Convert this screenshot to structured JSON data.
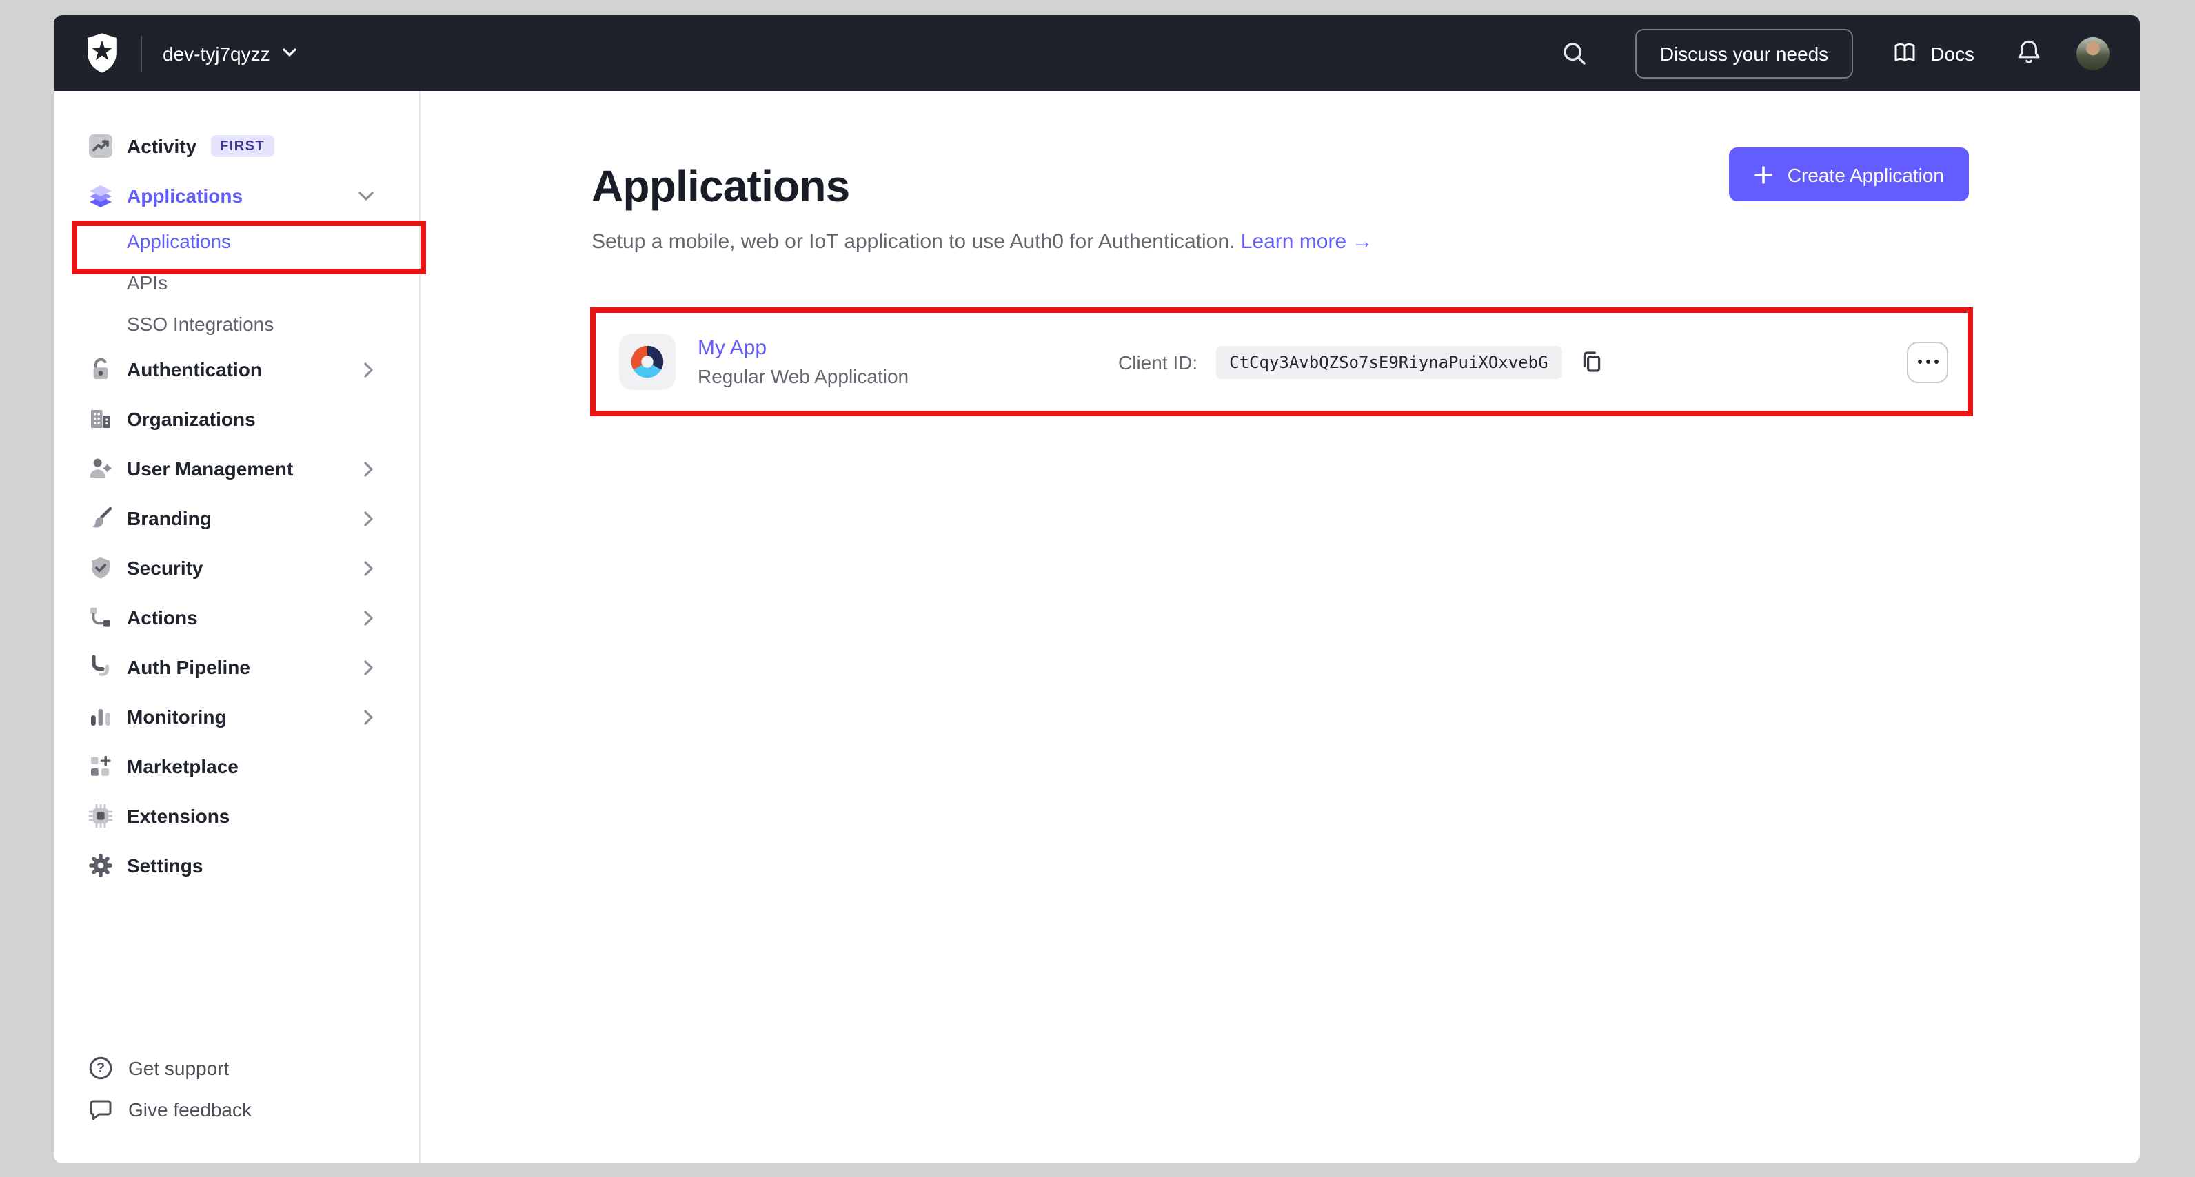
{
  "topbar": {
    "tenant": "dev-tyj7qyzz",
    "discuss_label": "Discuss your needs",
    "docs_label": "Docs"
  },
  "sidebar": {
    "items": [
      {
        "label": "Activity",
        "icon": "activity-icon",
        "badge": "FIRST"
      },
      {
        "label": "Applications",
        "icon": "layers-icon",
        "chevron": "down",
        "active": true,
        "children": [
          {
            "label": "Applications",
            "active": true
          },
          {
            "label": "APIs"
          },
          {
            "label": "SSO Integrations"
          }
        ]
      },
      {
        "label": "Authentication",
        "icon": "lock-icon",
        "chevron": "right"
      },
      {
        "label": "Organizations",
        "icon": "building-icon"
      },
      {
        "label": "User Management",
        "icon": "user-gear-icon",
        "chevron": "right"
      },
      {
        "label": "Branding",
        "icon": "paintbrush-icon",
        "chevron": "right"
      },
      {
        "label": "Security",
        "icon": "shield-check-icon",
        "chevron": "right"
      },
      {
        "label": "Actions",
        "icon": "flow-icon",
        "chevron": "right"
      },
      {
        "label": "Auth Pipeline",
        "icon": "pipeline-icon",
        "chevron": "right"
      },
      {
        "label": "Monitoring",
        "icon": "bar-chart-icon",
        "chevron": "right"
      },
      {
        "label": "Marketplace",
        "icon": "grid-plus-icon"
      },
      {
        "label": "Extensions",
        "icon": "chip-icon"
      },
      {
        "label": "Settings",
        "icon": "gear-icon"
      }
    ],
    "footer": [
      {
        "label": "Get support",
        "icon": "help-circle-icon"
      },
      {
        "label": "Give feedback",
        "icon": "chat-bubble-icon"
      }
    ]
  },
  "main": {
    "title": "Applications",
    "subtitle": "Setup a mobile, web or IoT application to use Auth0 for Authentication.",
    "learn_more_label": "Learn more",
    "learn_more_arrow": "→",
    "create_button_label": "Create Application",
    "application": {
      "name": "My App",
      "type": "Regular Web Application",
      "client_id_label": "Client ID:",
      "client_id": "CtCqy3AvbQZSo7sE9RiynaPuiXOxvebG"
    }
  },
  "colors": {
    "accent": "#635dff",
    "topbar_bg": "#1e222b",
    "annotation_red": "#e91414",
    "text_dark": "#191d27",
    "text_muted": "#63666e",
    "chip_bg": "#f0f0f2",
    "badge_bg": "#e6e3fc",
    "badge_text": "#3d3890",
    "app_logo_orange": "#e8532c",
    "app_logo_navy": "#1f2a56",
    "app_logo_blue": "#49c5f2"
  }
}
